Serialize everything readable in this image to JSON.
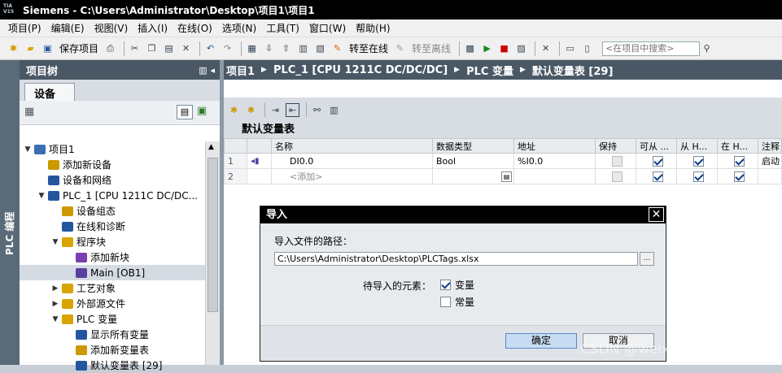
{
  "window": {
    "title": "Siemens  -  C:\\Users\\Administrator\\Desktop\\项目1\\项目1",
    "logo_text": "TIA V15"
  },
  "menu": [
    "项目(P)",
    "编辑(E)",
    "视图(V)",
    "插入(I)",
    "在线(O)",
    "选项(N)",
    "工具(T)",
    "窗口(W)",
    "帮助(H)"
  ],
  "toolbar": {
    "save_project": "保存项目",
    "go_online": "转至在线",
    "go_offline": "转至离线",
    "search_placeholder": "<在项目中搜索>"
  },
  "side_tab": "PLC 编程",
  "project_tree": {
    "header": "项目树",
    "tab": "设备",
    "items": [
      {
        "label": "项目1",
        "level": 0,
        "arrow": "▼"
      },
      {
        "label": "添加新设备",
        "level": 1,
        "arrow": ""
      },
      {
        "label": "设备和网络",
        "level": 1,
        "arrow": ""
      },
      {
        "label": "PLC_1 [CPU 1211C DC/DC...",
        "level": 1,
        "arrow": "▼"
      },
      {
        "label": "设备组态",
        "level": 2,
        "arrow": ""
      },
      {
        "label": "在线和诊断",
        "level": 2,
        "arrow": ""
      },
      {
        "label": "程序块",
        "level": 2,
        "arrow": "▼"
      },
      {
        "label": "添加新块",
        "level": 3,
        "arrow": ""
      },
      {
        "label": "Main [OB1]",
        "level": 3,
        "arrow": ""
      },
      {
        "label": "工艺对象",
        "level": 2,
        "arrow": "▶"
      },
      {
        "label": "外部源文件",
        "level": 2,
        "arrow": "▶"
      },
      {
        "label": "PLC 变量",
        "level": 2,
        "arrow": "▼"
      },
      {
        "label": "显示所有变量",
        "level": 3,
        "arrow": ""
      },
      {
        "label": "添加新变量表",
        "level": 3,
        "arrow": ""
      },
      {
        "label": "默认变量表 [29]",
        "level": 3,
        "arrow": ""
      }
    ]
  },
  "breadcrumb": [
    "项目1",
    "PLC_1 [CPU 1211C DC/DC/DC]",
    "PLC 变量",
    "默认变量表 [29]"
  ],
  "tag_table": {
    "title": "默认变量表",
    "columns": [
      "名称",
      "数据类型",
      "地址",
      "保持",
      "可从 ...",
      "从 H...",
      "在 H...",
      "注释"
    ],
    "rows": [
      {
        "num": "1",
        "name": "DI0.0",
        "type": "Bool",
        "address": "%I0.0",
        "comment": "启动"
      },
      {
        "num": "2",
        "name": "<添加>",
        "type": "",
        "address": "",
        "comment": ""
      }
    ]
  },
  "import_dialog": {
    "title": "导入",
    "path_label": "导入文件的路径：",
    "path_value": "C:\\Users\\Administrator\\Desktop\\PLCTags.xlsx",
    "browse_label": "...",
    "elements_label": "待导入的元素：",
    "option_tags": "变量",
    "option_tags_checked": true,
    "option_constants": "常量",
    "option_constants_checked": false,
    "ok": "确定",
    "cancel": "取消"
  },
  "watermark": "CSDN @weixin_44622526"
}
